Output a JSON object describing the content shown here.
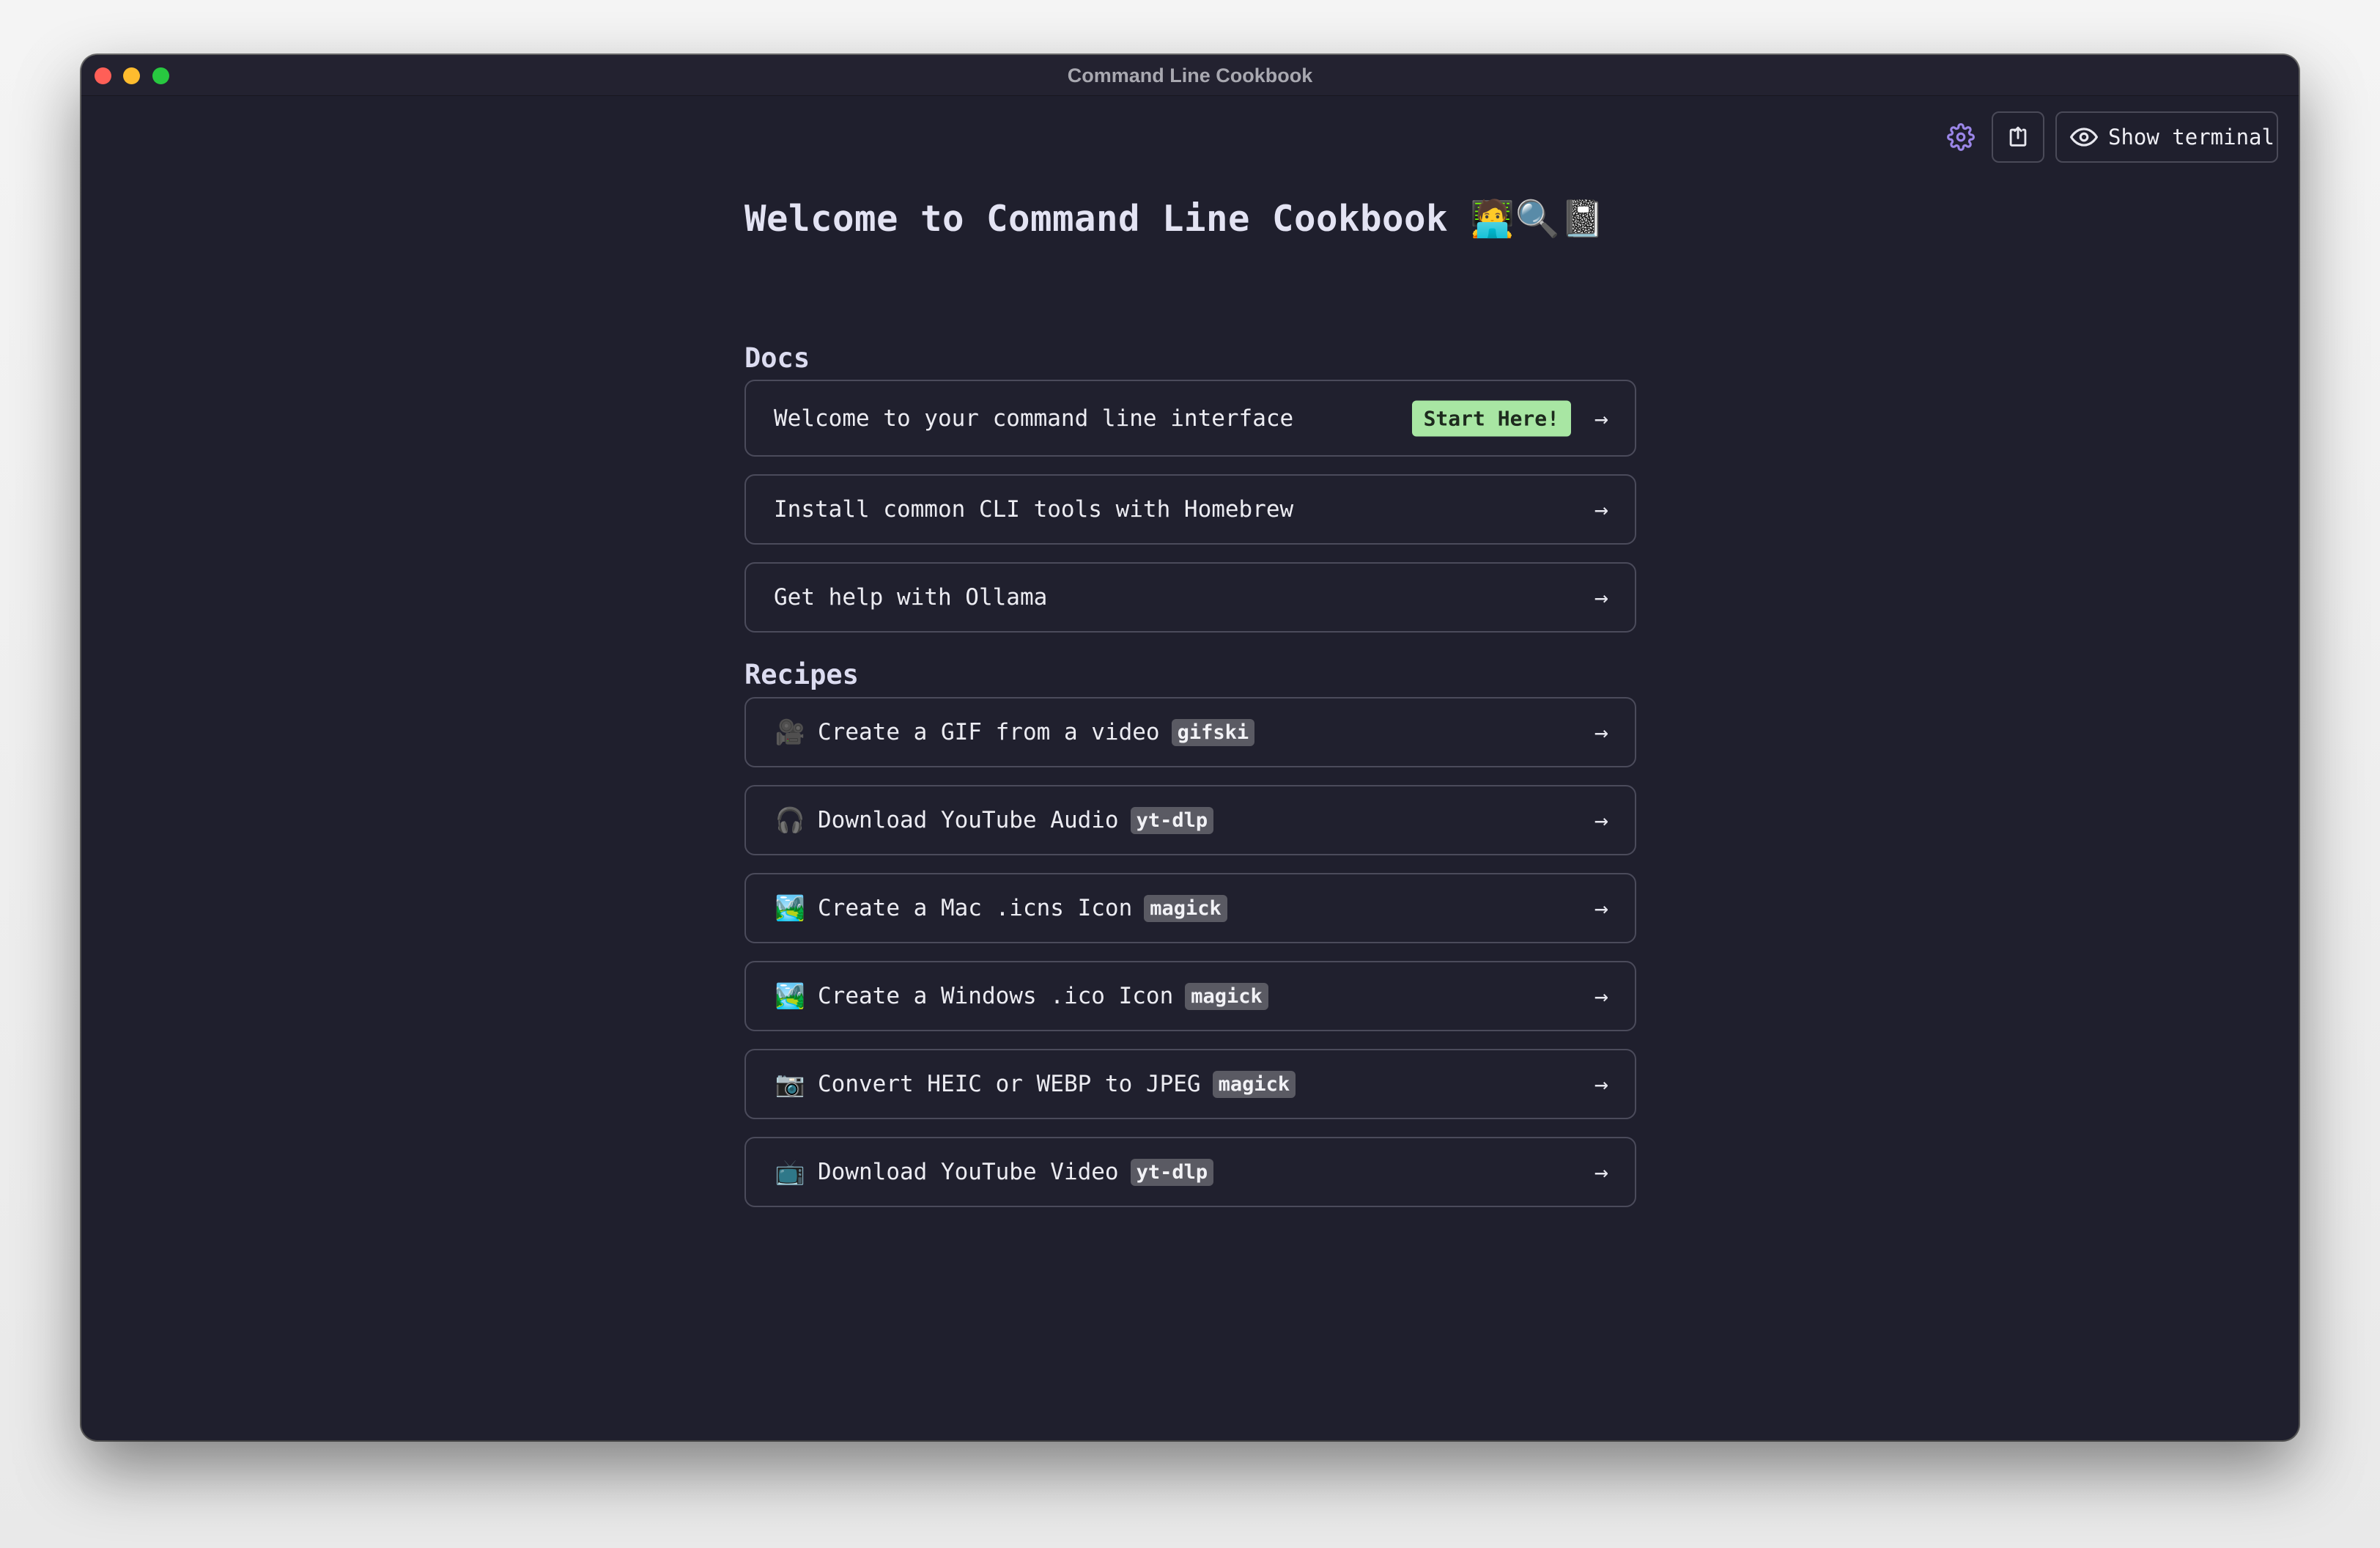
{
  "window": {
    "title": "Command Line Cookbook"
  },
  "toolbar": {
    "settings_icon": "gear-icon",
    "export_icon": "share-icon",
    "terminal_icon": "eye-icon",
    "terminal_label": "Show terminal",
    "accent": "#9b86e8"
  },
  "page": {
    "title": "Welcome to Command Line Cookbook 🧑‍💻🔍📓"
  },
  "docs": {
    "heading": "Docs",
    "items": [
      {
        "label": "Welcome to your command line interface",
        "badge": "Start Here!"
      },
      {
        "label": "Install common CLI tools with Homebrew"
      },
      {
        "label": "Get help with Ollama"
      }
    ]
  },
  "recipes": {
    "heading": "Recipes",
    "items": [
      {
        "emoji": "🎥",
        "label": "Create a GIF from a video",
        "tag": "gifski"
      },
      {
        "emoji": "🎧",
        "label": "Download YouTube Audio",
        "tag": "yt-dlp"
      },
      {
        "emoji": "🏞️",
        "label": "Create a Mac .icns Icon",
        "tag": "magick"
      },
      {
        "emoji": "🏞️",
        "label": "Create a Windows .ico Icon",
        "tag": "magick"
      },
      {
        "emoji": "📷",
        "label": "Convert HEIC or WEBP to JPEG",
        "tag": "magick"
      },
      {
        "emoji": "📺",
        "label": "Download YouTube Video",
        "tag": "yt-dlp"
      }
    ]
  },
  "colors": {
    "background": "#1f1f2d",
    "start_badge": "#a8e6a3",
    "tag": "#5a5a63"
  }
}
